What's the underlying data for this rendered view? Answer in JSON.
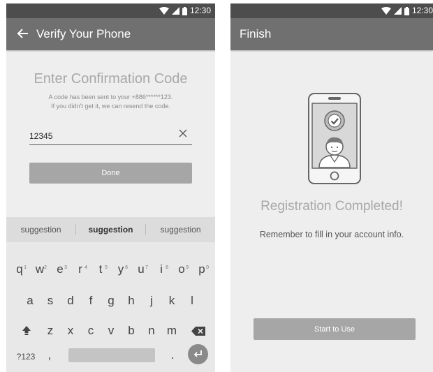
{
  "left": {
    "status": {
      "time": "12:30"
    },
    "app_bar": {
      "title": "Verify Your Phone"
    },
    "heading": "Enter Confirmation Code",
    "sub_line1": "A code has been sent to your +886******123.",
    "sub_line2": "If you didn't get it, we can resend the code.",
    "code_input": {
      "value": "12345",
      "placeholder": ""
    },
    "done_label": "Done",
    "keyboard": {
      "suggestions": [
        "suggestion",
        "suggestion",
        "suggestion"
      ],
      "row1": [
        {
          "k": "q",
          "n": "1"
        },
        {
          "k": "w",
          "n": "2"
        },
        {
          "k": "e",
          "n": "3"
        },
        {
          "k": "r",
          "n": "4"
        },
        {
          "k": "t",
          "n": "5"
        },
        {
          "k": "y",
          "n": "6"
        },
        {
          "k": "u",
          "n": "7"
        },
        {
          "k": "i",
          "n": "8"
        },
        {
          "k": "o",
          "n": "9"
        },
        {
          "k": "p",
          "n": "0"
        }
      ],
      "row2": [
        "a",
        "s",
        "d",
        "f",
        "g",
        "h",
        "j",
        "k",
        "l"
      ],
      "row3": [
        "z",
        "x",
        "c",
        "v",
        "b",
        "n",
        "m"
      ],
      "symbols_label": "?123",
      "comma": ",",
      "period": "."
    }
  },
  "right": {
    "status": {
      "time": "12:30"
    },
    "app_bar": {
      "title": "Finish"
    },
    "heading": "Registration Completed!",
    "subtext": "Remember to fill in your account info.",
    "start_label": "Start to Use"
  },
  "icons": {
    "wifi": "wifi-icon",
    "signal": "signal-icon",
    "battery": "battery-icon",
    "back": "arrow-left-icon",
    "clear": "close-icon",
    "shift": "shift-icon",
    "backspace": "backspace-icon",
    "enter": "enter-icon",
    "check": "check-circle-icon",
    "avatar": "user-avatar-icon"
  },
  "colors": {
    "status_bar": "#4d4d4d",
    "app_bar": "#707070",
    "background": "#eeeeee",
    "button": "#a6a6a6",
    "keyboard": "#e8e8e8"
  }
}
